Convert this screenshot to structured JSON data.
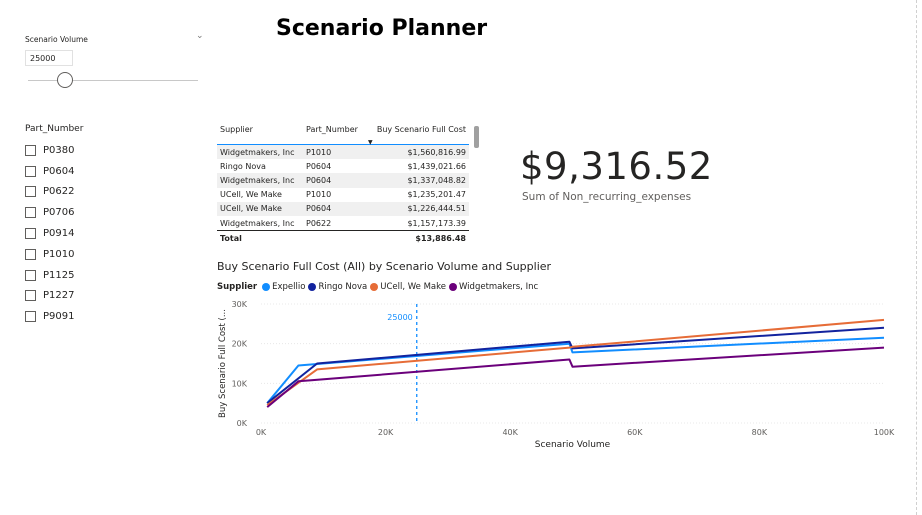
{
  "title": "Scenario Planner",
  "scenario_volume": {
    "label": "Scenario Volume",
    "value": "25000",
    "slider_fraction": 0.22
  },
  "part_number_slicer": {
    "title": "Part_Number",
    "items": [
      "P0380",
      "P0604",
      "P0622",
      "P0706",
      "P0914",
      "P1010",
      "P1125",
      "P1227",
      "P9091"
    ]
  },
  "table": {
    "headers": [
      "Supplier",
      "Part_Number",
      "Buy Scenario Full Cost"
    ],
    "rows": [
      [
        "Widgetmakers, Inc",
        "P1010",
        "$1,560,816.99"
      ],
      [
        "Ringo Nova",
        "P0604",
        "$1,439,021.66"
      ],
      [
        "Widgetmakers, Inc",
        "P0604",
        "$1,337,048.82"
      ],
      [
        "UCell, We Make",
        "P1010",
        "$1,235,201.47"
      ],
      [
        "UCell, We Make",
        "P0604",
        "$1,226,444.51"
      ],
      [
        "Widgetmakers, Inc",
        "P0622",
        "$1,157,173.39"
      ]
    ],
    "total_label": "Total",
    "total_value": "$13,886.48"
  },
  "card": {
    "value": "$9,316.52",
    "label": "Sum of Non_recurring_expenses"
  },
  "chart_data": {
    "type": "line",
    "title": "Buy Scenario Full Cost (All) by Scenario Volume and Supplier",
    "legend_title": "Supplier",
    "xlabel": "Scenario Volume",
    "ylabel": "Buy Scenario Full Cost (...",
    "x_ticks": [
      "0K",
      "20K",
      "40K",
      "60K",
      "80K",
      "100K"
    ],
    "y_ticks": [
      "0K",
      "10K",
      "20K",
      "30K"
    ],
    "xlim": [
      0,
      100000
    ],
    "ylim": [
      0,
      30000
    ],
    "reference_line": {
      "x": 25000,
      "label": "25000"
    },
    "series": [
      {
        "name": "Expellio",
        "color": "#118DFF",
        "x": [
          1000,
          6000,
          49500,
          50000,
          100000
        ],
        "y": [
          5000,
          14500,
          20000,
          17800,
          21500
        ]
      },
      {
        "name": "Ringo Nova",
        "color": "#12239E",
        "x": [
          1000,
          9000,
          49500,
          50000,
          100000
        ],
        "y": [
          5000,
          15000,
          20500,
          18800,
          24000
        ]
      },
      {
        "name": "UCell, We Make",
        "color": "#E66C37",
        "x": [
          1000,
          9000,
          49500,
          50000,
          100000
        ],
        "y": [
          4500,
          13500,
          19000,
          19200,
          26000
        ]
      },
      {
        "name": "Widgetmakers, Inc",
        "color": "#6B007B",
        "x": [
          1000,
          6000,
          49500,
          50000,
          100000
        ],
        "y": [
          4000,
          10500,
          16000,
          14200,
          19000
        ]
      }
    ]
  }
}
